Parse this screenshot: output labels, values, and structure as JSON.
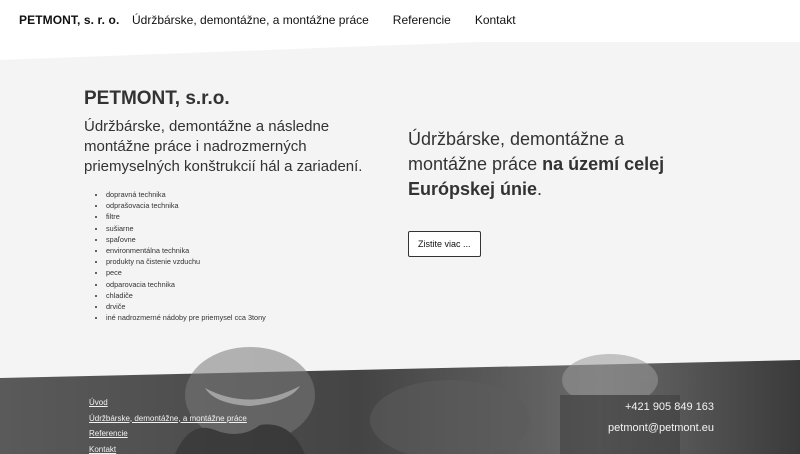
{
  "nav": {
    "brand": "PETMONT, s. r. o.",
    "links": [
      "Údržbárske, demontážne, a montážne práce",
      "Referencie",
      "Kontakt"
    ]
  },
  "hero": {
    "title": "PETMONT, s.r.o.",
    "subtitle": "Údržbárske, demontážne a následne montážne práce i nadrozmerných priemyselných konštrukcií hál a zariadení.",
    "products": [
      "dopravná technika",
      "odprašovacia technika",
      "filtre",
      "sušiarne",
      "spaľovne",
      "environmentálna technika",
      "produkty na čistenie vzduchu",
      "pece",
      "odparovacia technika",
      "chladiče",
      "drviče",
      "iné nadrozmerné nádoby pre priemysel cca 3tony"
    ],
    "tagline_start": "Údržbárske, demontážne a montážne práce ",
    "tagline_bold": "na území celej Európskej únie",
    "tagline_end": ".",
    "cta_label": "Zistite viac ..."
  },
  "footer": {
    "links": [
      "Úvod",
      "Údržbárske, demontážne, a montážne práce",
      "Referencie",
      "Kontakt"
    ],
    "phone": "+421 905 849 163",
    "email": "petmont@petmont.eu"
  },
  "colors": {
    "hero_bg": "#f4f4f4",
    "footer_bg": "#4a4a4a",
    "text": "#333333"
  }
}
